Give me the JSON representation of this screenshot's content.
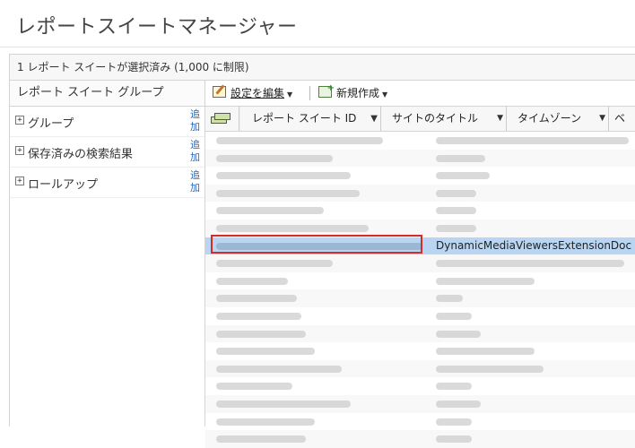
{
  "window": {
    "title": "レポートスイートマネージャー"
  },
  "status": {
    "text": "1 レポート スイートが選択済み (1,000 に制限)"
  },
  "left_panel": {
    "header": "レポート スイート グループ",
    "groups": [
      {
        "label": "グループ",
        "add_label": "追加",
        "expander": "+"
      },
      {
        "label": "保存済みの検索結果",
        "add_label": "追加",
        "expander": "+"
      },
      {
        "label": "ロールアップ",
        "add_label": "追加",
        "expander": "+"
      }
    ]
  },
  "toolbar": {
    "edit_label": "設定を編集",
    "new_label": "新規作成",
    "edit_icon": "edit-settings-icon",
    "new_icon": "new-item-icon"
  },
  "columns": {
    "id": "レポート スイート ID",
    "title": "サイトのタイトル",
    "timezone": "タイムゾーン",
    "more": "ベ"
  },
  "rows": [
    {
      "selected": false,
      "title": ""
    },
    {
      "selected": false,
      "title": ""
    },
    {
      "selected": false,
      "title": ""
    },
    {
      "selected": false,
      "title": ""
    },
    {
      "selected": false,
      "title": ""
    },
    {
      "selected": false,
      "title": ""
    },
    {
      "selected": true,
      "title": "DynamicMediaViewersExtensionDoc"
    },
    {
      "selected": false,
      "title": ""
    },
    {
      "selected": false,
      "title": ""
    },
    {
      "selected": false,
      "title": ""
    },
    {
      "selected": false,
      "title": ""
    },
    {
      "selected": false,
      "title": ""
    },
    {
      "selected": false,
      "title": ""
    },
    {
      "selected": false,
      "title": ""
    },
    {
      "selected": false,
      "title": ""
    },
    {
      "selected": false,
      "title": ""
    },
    {
      "selected": false,
      "title": ""
    },
    {
      "selected": false,
      "title": ""
    }
  ],
  "colors": {
    "selection": "#b9d5f1",
    "highlight_border": "#d52b2b",
    "link": "#2a66b8"
  }
}
